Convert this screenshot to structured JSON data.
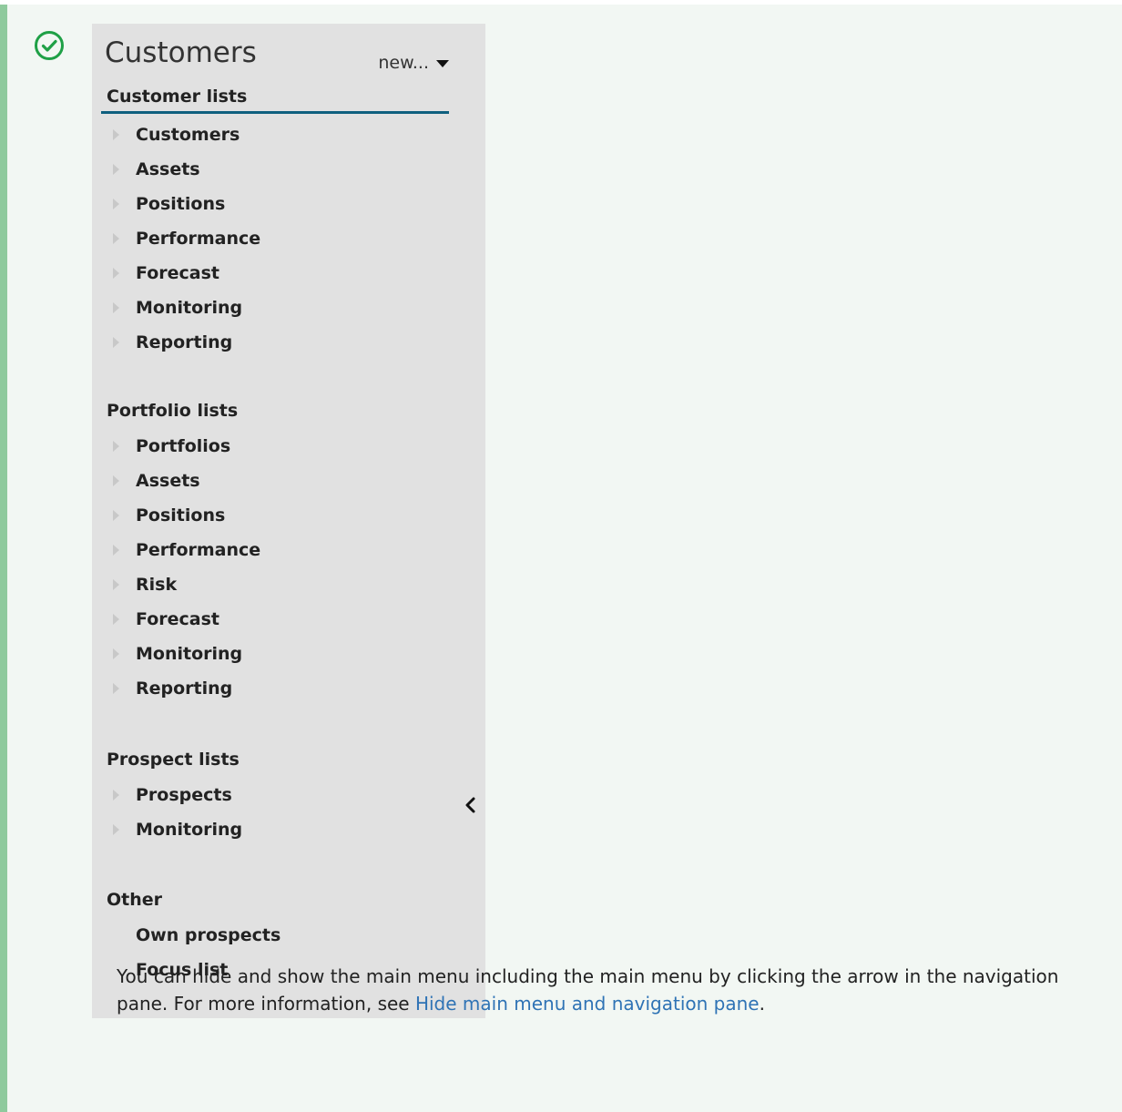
{
  "nav": {
    "title": "Customers",
    "new_label": "new...",
    "sections": [
      {
        "title": "Customer lists",
        "items": [
          "Customers",
          "Assets",
          "Positions",
          "Performance",
          "Forecast",
          "Monitoring",
          "Reporting"
        ]
      },
      {
        "title": "Portfolio lists",
        "items": [
          "Portfolios",
          "Assets",
          "Positions",
          "Performance",
          "Risk",
          "Forecast",
          "Monitoring",
          "Reporting"
        ]
      },
      {
        "title": "Prospect lists",
        "items": [
          "Prospects",
          "Monitoring"
        ]
      },
      {
        "title": "Other",
        "items": [
          "Own prospects",
          "Focus list"
        ]
      }
    ]
  },
  "note": {
    "text_before": "You can hide and show the main menu including the main menu by clicking the arrow in the navigation pane. For more information, see ",
    "link_text": "Hide main menu and navigation pane",
    "text_after": "."
  },
  "colors": {
    "note_bg": "#f2f7f3",
    "note_bar": "#8fca9d",
    "check_icon": "#1fa046",
    "nav_bg": "#e1e1e1",
    "active_underline": "#0e5f7e",
    "link": "#2f73b5"
  },
  "icons": {
    "note_icon": "check-circle-icon",
    "item_icon": "triangle-right-icon",
    "dropdown_icon": "caret-down-icon",
    "collapse_icon": "chevron-left-icon"
  }
}
